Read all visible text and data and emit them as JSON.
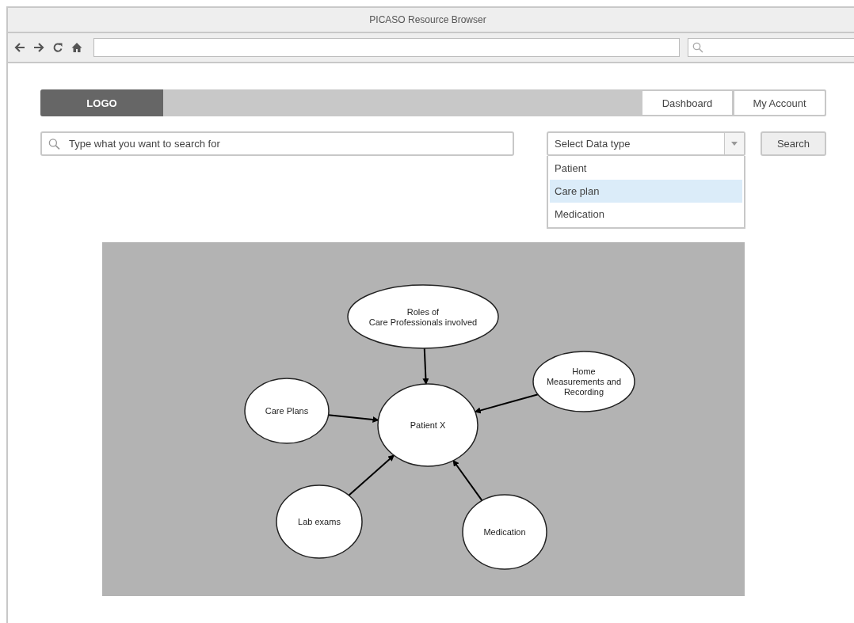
{
  "window": {
    "title": "PICASO Resource Browser"
  },
  "header": {
    "logo": "LOGO",
    "nav": [
      {
        "label": "Dashboard"
      },
      {
        "label": "My Account"
      }
    ]
  },
  "search": {
    "placeholder": "Type what you want to search for"
  },
  "data_type_select": {
    "value": "Select Data type",
    "expanded": true,
    "options": [
      {
        "label": "Patient",
        "selected": false
      },
      {
        "label": "Care plan",
        "selected": true
      },
      {
        "label": "Medication",
        "selected": false
      }
    ]
  },
  "search_button": "Search",
  "diagram": {
    "nodes": [
      {
        "kind": "satellite",
        "lines": [
          "Roles of",
          "Care Professionals involved"
        ]
      },
      {
        "kind": "satellite",
        "lines": [
          "Home",
          "Measurements and",
          "Recording"
        ]
      },
      {
        "kind": "satellite",
        "lines": [
          "Care Plans"
        ]
      },
      {
        "kind": "center",
        "lines": [
          "Patient X"
        ]
      },
      {
        "kind": "satellite",
        "lines": [
          "Lab exams"
        ]
      },
      {
        "kind": "satellite",
        "lines": [
          "Medication"
        ]
      }
    ]
  }
}
